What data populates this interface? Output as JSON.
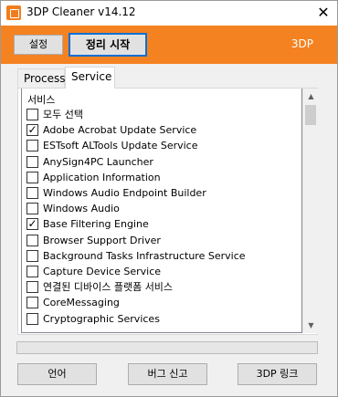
{
  "window": {
    "title": "3DP Cleaner v14.12",
    "close_glyph": "✕",
    "app_icon": "3dp-cleaner-icon"
  },
  "header": {
    "settings_label": "설정",
    "clean_label": "정리 시작",
    "brand": "3DP",
    "accent_color": "#f58220",
    "focus_color": "#0a6fd6"
  },
  "tabs": [
    {
      "label": "Process",
      "active": false
    },
    {
      "label": "Service",
      "active": true
    }
  ],
  "list": {
    "header": "서비스",
    "items": [
      {
        "label": "모두 선택",
        "checked": false
      },
      {
        "label": "Adobe Acrobat Update Service",
        "checked": true
      },
      {
        "label": "ESTsoft ALTools Update Service",
        "checked": false
      },
      {
        "label": "AnySign4PC Launcher",
        "checked": false
      },
      {
        "label": "Application Information",
        "checked": false
      },
      {
        "label": "Windows Audio Endpoint Builder",
        "checked": false
      },
      {
        "label": "Windows Audio",
        "checked": false
      },
      {
        "label": "Base Filtering Engine",
        "checked": true
      },
      {
        "label": "Browser Support Driver",
        "checked": false
      },
      {
        "label": "Background Tasks Infrastructure Service",
        "checked": false
      },
      {
        "label": "Capture Device Service",
        "checked": false
      },
      {
        "label": "연결된 디바이스 플랫폼 서비스",
        "checked": false
      },
      {
        "label": "CoreMessaging",
        "checked": false
      },
      {
        "label": "Cryptographic Services",
        "checked": false
      }
    ]
  },
  "scrollbar": {
    "up_glyph": "▲",
    "down_glyph": "▼"
  },
  "progress": {
    "value": 0
  },
  "footer": {
    "language_label": "언어",
    "bug_report_label": "버그 신고",
    "link_label": "3DP 링크"
  }
}
